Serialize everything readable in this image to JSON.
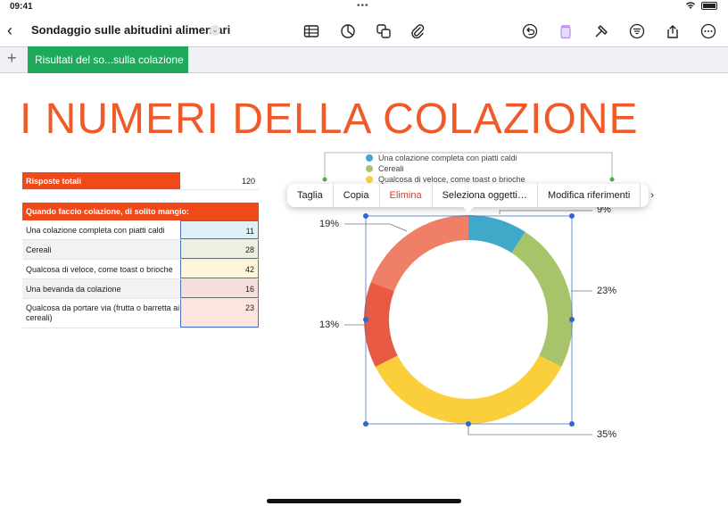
{
  "status_bar": {
    "time": "09:41",
    "dots": "•••"
  },
  "toolbar": {
    "back_label": "‹",
    "title": "Sondaggio sulle abitudini alimentari",
    "chevron": "⌄"
  },
  "tabs": {
    "add_label": "+",
    "sheet_name": "Risultati del so...sulla colazione"
  },
  "headline": "I NUMERI DELLA COLAZIONE",
  "total_table": {
    "label": "Risposte totali",
    "value": "120"
  },
  "breakfast_table": {
    "header": "Quando faccio colazione, di solito mangio:",
    "rows": [
      {
        "label": "Una colazione completa con piatti caldi",
        "value": "11"
      },
      {
        "label": "Cereali",
        "value": "28"
      },
      {
        "label": "Qualcosa di veloce, come toast o brioche",
        "value": "42"
      },
      {
        "label": "Una bevanda da colazione",
        "value": "16"
      },
      {
        "label": "Qualcosa da portare via (frutta o barretta ai cereali)",
        "value": "23"
      }
    ]
  },
  "context_menu": {
    "items": [
      "Taglia",
      "Copia",
      "Elimina",
      "Seleziona oggetti…",
      "Modifica riferimenti"
    ],
    "more": "›"
  },
  "colors": {
    "accent": "#f05a28",
    "sheet_tab": "#1daa5b",
    "selection": "#4a72c4",
    "row_fills": [
      "#dff0f6",
      "#edf1e1",
      "#fdf6d8",
      "#f6dedd",
      "#fde4de"
    ]
  },
  "chart_data": {
    "type": "pie",
    "variant": "donut",
    "legend": [
      "Una colazione completa con piatti caldi",
      "Cereali",
      "Qualcosa di veloce, come toast o brioche"
    ],
    "legend_placement": "top",
    "slices": [
      {
        "name": "Una colazione completa con piatti caldi",
        "value": 11,
        "label": "9%",
        "color": "#40a8c8"
      },
      {
        "name": "Cereali",
        "value": 28,
        "label": "23%",
        "color": "#a8c46a"
      },
      {
        "name": "Qualcosa di veloce, come toast o brioche",
        "value": 42,
        "label": "35%",
        "color": "#fbcf3c"
      },
      {
        "name": "Una bevanda da colazione",
        "value": 16,
        "label": "13%",
        "color": "#e85a44"
      },
      {
        "name": "Qualcosa da portare via (frutta o barretta ai cereali)",
        "value": 23,
        "label": "19%",
        "color": "#ef8067"
      }
    ]
  }
}
